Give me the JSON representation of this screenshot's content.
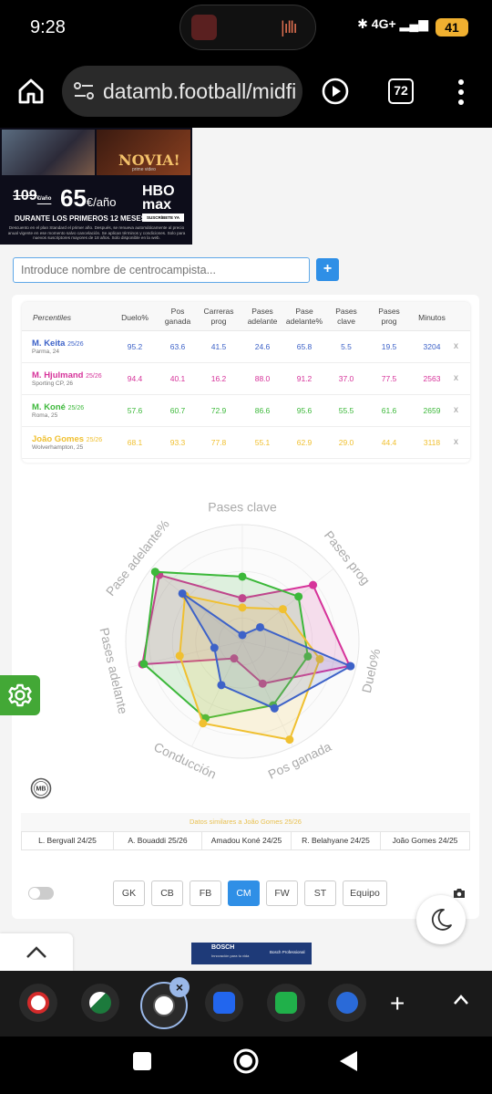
{
  "status": {
    "time": "9:28",
    "network": "4G+",
    "battery": "41"
  },
  "browser": {
    "url": "datamb.football/midfi",
    "tab_count": "72"
  },
  "ad": {
    "top_title": "NOVIA!",
    "top_sub": "prime video",
    "old_price": "109",
    "old_price_unit": "€/año",
    "new_price": "65",
    "new_price_unit": "€/año",
    "brand": "HBO max",
    "cta": "SUSCRÍBETE YA",
    "during": "DURANTE LOS PRIMEROS 12 MESES",
    "fine_print": "Descuento en el plan Standard el primer año. Después, se renueva automáticamente al precio anual vigente en ese momento salvo cancelación. Se aplican términos y condiciones. Solo para nuevos suscriptores mayores de 18 años. Solo disponible en la web."
  },
  "search": {
    "placeholder": "Introduce nombre de centrocampista...",
    "add_label": "+"
  },
  "table": {
    "headers": [
      "Percentiles",
      "Duelo%",
      "Pos ganada",
      "Carreras prog",
      "Pases adelante",
      "Pase adelante%",
      "Pases clave",
      "Pases prog",
      "Minutos"
    ],
    "remove_label": "x",
    "rows": [
      {
        "name": "M. Keita",
        "season": "25/26",
        "team": "Parma, 24",
        "color": "#3d62c8",
        "values": [
          "95.2",
          "63.6",
          "41.5",
          "24.6",
          "65.8",
          "5.5",
          "19.5",
          "3204"
        ]
      },
      {
        "name": "M. Hjulmand",
        "season": "25/26",
        "team": "Sporting CP, 26",
        "color": "#d6339a",
        "values": [
          "94.4",
          "40.1",
          "16.2",
          "88.0",
          "91.2",
          "37.0",
          "77.5",
          "2563"
        ]
      },
      {
        "name": "M. Koné",
        "season": "25/26",
        "team": "Roma, 25",
        "color": "#3cb83a",
        "values": [
          "57.6",
          "60.7",
          "72.9",
          "86.6",
          "95.6",
          "55.5",
          "61.6",
          "2659"
        ]
      },
      {
        "name": "João Gomes",
        "season": "25/26",
        "team": "Wolverhampton, 25",
        "color": "#f0c030",
        "values": [
          "68.1",
          "93.3",
          "77.8",
          "55.1",
          "62.9",
          "29.0",
          "44.4",
          "3118"
        ]
      }
    ]
  },
  "radar": {
    "axes": [
      "Pases clave",
      "Pases prog",
      "Duelo%",
      "Pos ganada",
      "Conducción",
      "Pases adelante",
      "Pase adelante%"
    ],
    "series": [
      {
        "color": "#d6339a",
        "values": [
          37.0,
          77.5,
          94.4,
          40.1,
          16.2,
          88.0,
          91.2
        ]
      },
      {
        "color": "#3cb83a",
        "values": [
          55.5,
          61.6,
          57.6,
          60.7,
          72.9,
          86.6,
          95.6
        ]
      },
      {
        "color": "#f0c030",
        "values": [
          29.0,
          44.4,
          68.1,
          93.3,
          77.8,
          55.1,
          62.9
        ]
      },
      {
        "color": "#3d62c8",
        "values": [
          5.5,
          19.5,
          95.2,
          63.6,
          41.5,
          24.6,
          65.8
        ]
      }
    ]
  },
  "similar": {
    "title": "Datos similares a João Gomes 25/26",
    "items": [
      "L. Bergvall 24/25",
      "A. Bouaddi 25/26",
      "Amadou Koné 24/25",
      "R. Belahyane 24/25",
      "João Gomes 24/25"
    ]
  },
  "positions": {
    "buttons": [
      "GK",
      "CB",
      "FB",
      "CM",
      "FW",
      "ST",
      "Equipo"
    ],
    "active": "CM"
  },
  "bosch": {
    "logo": "BOSCH",
    "tagline": "Innovación para tu vida",
    "product": "Bosch Professional"
  }
}
